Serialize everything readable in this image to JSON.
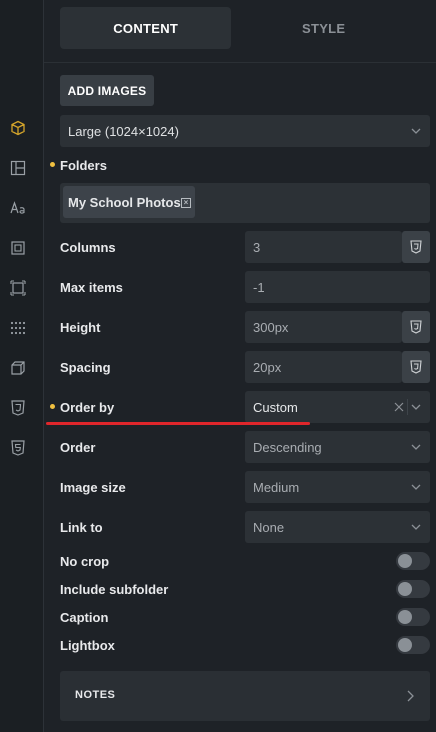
{
  "tabs": [
    {
      "label": "CONTENT"
    },
    {
      "label": "STYLE"
    }
  ],
  "add_images_label": "ADD IMAGES",
  "image_size_select": "Large (1024×1024)",
  "folders": {
    "label": "Folders",
    "chips": [
      "My School Photos"
    ]
  },
  "fields": {
    "columns": {
      "label": "Columns",
      "value": "3"
    },
    "max_items": {
      "label": "Max items",
      "value": "-1"
    },
    "height": {
      "label": "Height",
      "value": "300px"
    },
    "spacing": {
      "label": "Spacing",
      "value": "20px"
    }
  },
  "selects": {
    "order_by": {
      "label": "Order by",
      "value": "Custom"
    },
    "order": {
      "label": "Order",
      "value": "Descending"
    },
    "image_size": {
      "label": "Image size",
      "value": "Medium"
    },
    "link_to": {
      "label": "Link to",
      "value": "None"
    }
  },
  "toggles": [
    {
      "label": "No crop",
      "on": false
    },
    {
      "label": "Include subfolder",
      "on": false
    },
    {
      "label": "Caption",
      "on": false
    },
    {
      "label": "Lightbox",
      "on": false
    }
  ],
  "notes_label": "NOTES",
  "sidebar_icons": [
    "cube-icon",
    "layout-icon",
    "typography-icon",
    "spacing-icon",
    "box-icon",
    "grid-dots-icon",
    "3d-box-icon",
    "css3-icon",
    "html5-icon"
  ],
  "colors": {
    "accent_dot": "#f0c040",
    "annotation_line": "#e0262b",
    "active_icon": "#d4a42a"
  }
}
